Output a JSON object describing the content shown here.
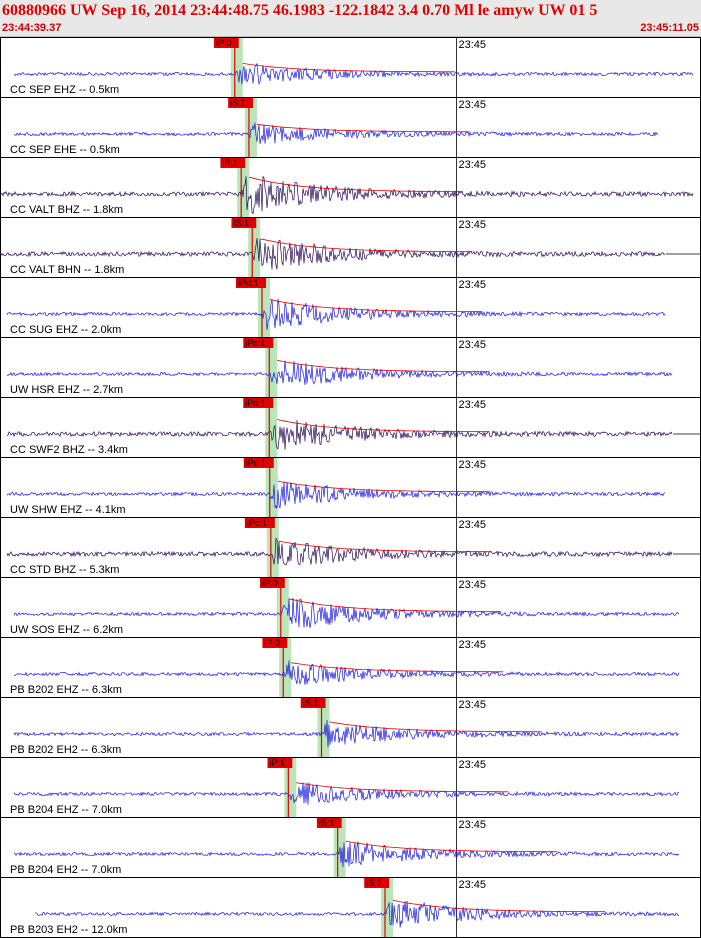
{
  "header": {
    "title": "60880966 UW Sep 16, 2014 23:44:48.75   46.1983 -122.1842  3.4 0.70 Ml le amyw UW 01   5",
    "start_time": "23:44:39.37",
    "end_time": "23:45:11.05"
  },
  "colors": {
    "header_text": "#e00000",
    "trace_blue": "#1a1ae6",
    "trace_dark": "#2a0a55",
    "pick_marker": "#e00000",
    "window_shade": "#b9e5b9"
  },
  "chart_data": {
    "type": "seismogram",
    "x_label": "23:45",
    "traces": [
      {
        "station_label": "CC SEP EHZ -- 0.5km",
        "pick": "iP:0",
        "pick_sec": 1.23,
        "color": "blue",
        "amp": 0.55,
        "start": 0.02,
        "end": 0.99
      },
      {
        "station_label": "CC SEP EHE -- 0.5km",
        "pick": "iS:1",
        "pick_sec": 1.87,
        "color": "blue",
        "amp": 0.5,
        "start": 0.02,
        "end": 0.94
      },
      {
        "station_label": "CC VALT BHZ -- 1.8km",
        "pick": "iP:1",
        "pick_sec": 1.52,
        "color": "dark",
        "amp": 0.95,
        "start": 0.0,
        "end": 0.99
      },
      {
        "station_label": "CC VALT BHN -- 1.8km",
        "pick": "iS:1",
        "pick_sec": 2.02,
        "color": "dark",
        "amp": 0.85,
        "start": 0.0,
        "end": 0.95
      },
      {
        "station_label": "CC SUG EHZ -- 2.0km",
        "pick": "iPd:1",
        "pick_sec": 2.46,
        "color": "blue",
        "amp": 0.8,
        "start": 0.01,
        "end": 0.95
      },
      {
        "station_label": "UW HSR EHZ -- 2.7km",
        "pick": "iPc:1",
        "pick_sec": 2.79,
        "color": "blue",
        "amp": 0.75,
        "start": 0.01,
        "end": 0.96
      },
      {
        "station_label": "CC SWF2 BHZ -- 3.4km",
        "pick": "iPd:1",
        "pick_sec": 2.79,
        "color": "dark",
        "amp": 0.8,
        "start": 0.01,
        "end": 0.96
      },
      {
        "station_label": "UW SHW EHZ -- 4.1km",
        "pick": "iPc:1",
        "pick_sec": 2.81,
        "color": "blue",
        "amp": 0.7,
        "start": 0.01,
        "end": 0.95
      },
      {
        "station_label": "CC STD BHZ -- 5.3km",
        "pick": "iPc:1",
        "pick_sec": 2.86,
        "color": "dark",
        "amp": 0.7,
        "start": 0.01,
        "end": 0.96
      },
      {
        "station_label": "UW SOS EHZ -- 6.2km",
        "pick": "iP:0",
        "pick_sec": 3.31,
        "color": "blue",
        "amp": 0.85,
        "start": 0.02,
        "end": 0.97
      },
      {
        "station_label": "PB B202 EHZ -- 6.3km",
        "pick": "iP:0",
        "pick_sec": 3.42,
        "color": "blue",
        "amp": 0.6,
        "start": 0.02,
        "end": 0.97
      },
      {
        "station_label": "PB B202 EH2 -- 6.3km",
        "pick": "iS:1",
        "pick_sec": 5.15,
        "color": "blue",
        "amp": 0.65,
        "start": 0.02,
        "end": 0.97
      },
      {
        "station_label": "PB B204 EHZ -- 7.0km",
        "pick": "iP:1",
        "pick_sec": 3.65,
        "color": "blue",
        "amp": 0.6,
        "start": 0.02,
        "end": 0.97
      },
      {
        "station_label": "PB B204 EH2 -- 7.0km",
        "pick": "iS:1",
        "pick_sec": 5.88,
        "color": "blue",
        "amp": 0.7,
        "start": 0.02,
        "end": 0.97
      },
      {
        "station_label": "PB B203 EH2 -- 12.0km",
        "pick": "iS:1",
        "pick_sec": 8.02,
        "color": "blue",
        "amp": 0.75,
        "start": 0.05,
        "end": 0.97
      }
    ]
  }
}
